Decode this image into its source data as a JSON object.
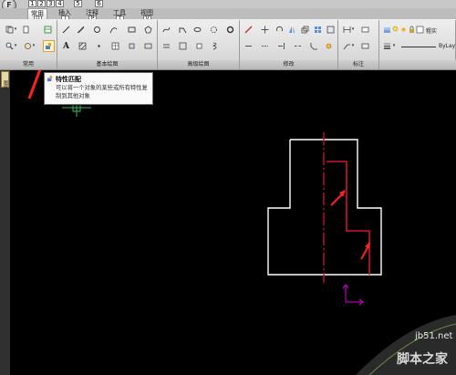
{
  "app": {
    "button_letter": "F"
  },
  "quick_access_keys": [
    "1",
    "2",
    "3",
    "4",
    "5",
    "6"
  ],
  "tabs": [
    {
      "label": "常用",
      "key": "U",
      "active": true
    },
    {
      "label": "插入",
      "key": "I",
      "active": false
    },
    {
      "label": "注释",
      "key": "P",
      "active": false
    },
    {
      "label": "工具",
      "key": "T",
      "active": false
    },
    {
      "label": "视图",
      "key": "V",
      "active": false
    }
  ],
  "ribbon": {
    "panels": [
      "常用",
      "基本绘图",
      "高级绘图",
      "修改",
      "标注"
    ],
    "layer_name": "粗实",
    "linetype": "ByLay"
  },
  "tooltip": {
    "title": "特性匹配",
    "body": "可以将一个对象的某些或所有特性复制到其他对象"
  },
  "side_palette": {
    "label": "图层"
  },
  "watermark": {
    "url": "jb51.net",
    "name": "脚本之家"
  },
  "colors": {
    "canvas": "#000000",
    "outline": "#ffffff",
    "centerline": "#c8102e",
    "ucs": "#b000b0",
    "crosshair": "#30c060",
    "annotation_arrow": "#ff2020"
  }
}
